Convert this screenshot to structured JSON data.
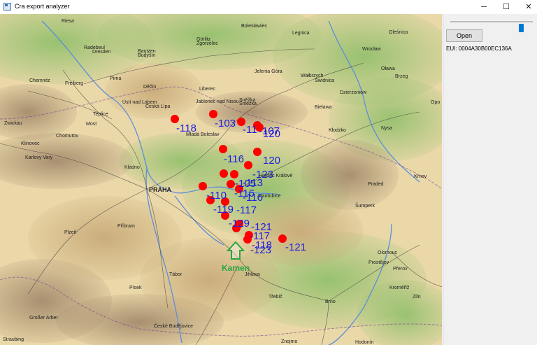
{
  "window": {
    "title": "Cra export analyzer",
    "minimize": "─",
    "maximize": "☐",
    "close": "✕"
  },
  "sidepanel": {
    "open_label": "Open",
    "eui_label": "EUI: 0004A30B00EC136A",
    "slider_level": 0.86
  },
  "map": {
    "marker_color": "#ff0000",
    "rssi_color": "#1e1ee0",
    "station_color": "#28a745",
    "station": "Kamen",
    "towns": [
      {
        "name": "Riesa"
      },
      {
        "name": "Bolesławiec"
      },
      {
        "name": "Legnica"
      },
      {
        "name": "Oleśnica"
      },
      {
        "name": "Radebeul"
      },
      {
        "name": "Dresden"
      },
      {
        "name": "Görlitz"
      },
      {
        "name": "Zgorzelec"
      },
      {
        "name": "Bautzen"
      },
      {
        "name": "Budyšín"
      },
      {
        "name": "Wrocław"
      },
      {
        "name": "Oława"
      },
      {
        "name": "Chemnitz"
      },
      {
        "name": "Freiberg"
      },
      {
        "name": "Pirna"
      },
      {
        "name": "Jelenia Góra"
      },
      {
        "name": "Wałbrzych"
      },
      {
        "name": "Świdnica"
      },
      {
        "name": "Brzeg"
      },
      {
        "name": "Děčín"
      },
      {
        "name": "Liberec"
      },
      {
        "name": "Ústí nad Labem"
      },
      {
        "name": "Česká Lípa"
      },
      {
        "name": "Jablonec nad Nisou"
      },
      {
        "name": "Sněžka"
      },
      {
        "name": "Śnieżka"
      },
      {
        "name": "Dzierżoniów"
      },
      {
        "name": "Bielawa"
      },
      {
        "name": "Opo"
      },
      {
        "name": "Teplice"
      },
      {
        "name": "Most"
      },
      {
        "name": "Zwickau"
      },
      {
        "name": "Chomutov"
      },
      {
        "name": "Mladá Boleslav"
      },
      {
        "name": "Kłodzko"
      },
      {
        "name": "Nysa"
      },
      {
        "name": "Klinovec"
      },
      {
        "name": "Karlovy Vary"
      },
      {
        "name": "Kladno"
      },
      {
        "name": "Hradec Králové"
      },
      {
        "name": "PRAHA"
      },
      {
        "name": "Pardubice"
      },
      {
        "name": "Krnov"
      },
      {
        "name": "Praded"
      },
      {
        "name": "Šumperk"
      },
      {
        "name": "Plzeň"
      },
      {
        "name": "Příbram"
      },
      {
        "name": "Olomouc"
      },
      {
        "name": "Prostějov"
      },
      {
        "name": "Přerov"
      },
      {
        "name": "Tábor"
      },
      {
        "name": "Jihlava"
      },
      {
        "name": "Kroměříž"
      },
      {
        "name": "Zlín"
      },
      {
        "name": "Písek"
      },
      {
        "name": "Třebíč"
      },
      {
        "name": "Brno"
      },
      {
        "name": "Großer Arber"
      },
      {
        "name": "České Budějovice"
      },
      {
        "name": "Znojmo"
      },
      {
        "name": "Hodonín"
      },
      {
        "name": "Straubing"
      },
      {
        "name": "Deggendorf"
      }
    ],
    "markers": [
      {
        "label": "-118"
      },
      {
        "label": "-103"
      },
      {
        "label": "-11"
      },
      {
        "label": "-107"
      },
      {
        "label": "120"
      },
      {
        "label": "-116"
      },
      {
        "label": "120"
      },
      {
        "label": "-123"
      },
      {
        "label": "-105"
      },
      {
        "label": "-113"
      },
      {
        "label": "-110"
      },
      {
        "label": "-116"
      },
      {
        "label": "-116"
      },
      {
        "label": "-119"
      },
      {
        "label": "-117"
      },
      {
        "label": "-129"
      },
      {
        "label": "-121"
      },
      {
        "label": "-117"
      },
      {
        "label": "-118"
      },
      {
        "label": "-123"
      },
      {
        "label": "-121"
      }
    ]
  }
}
